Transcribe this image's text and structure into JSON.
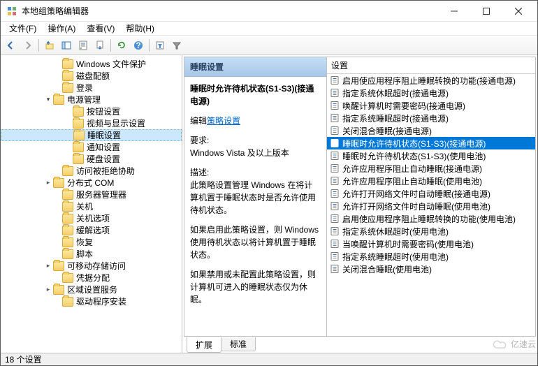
{
  "window": {
    "title": "本地组策略编辑器"
  },
  "menubar": {
    "items": [
      {
        "label": "文件(F)"
      },
      {
        "label": "操作(A)"
      },
      {
        "label": "查看(V)"
      },
      {
        "label": "帮助(H)"
      }
    ]
  },
  "toolbar": {
    "buttons": [
      {
        "name": "back-icon"
      },
      {
        "name": "forward-icon"
      },
      {
        "name": "up-icon"
      },
      {
        "name": "show-hide-tree-icon"
      },
      {
        "name": "properties-icon"
      },
      {
        "name": "export-icon"
      },
      {
        "name": "refresh-icon"
      },
      {
        "name": "help-icon"
      },
      {
        "name": "filter-options-icon"
      },
      {
        "name": "filter-icon"
      }
    ]
  },
  "tree": {
    "items": [
      {
        "indent": 75,
        "toggle": "",
        "label": "Windows 文件保护"
      },
      {
        "indent": 75,
        "toggle": "",
        "label": "磁盘配额"
      },
      {
        "indent": 75,
        "toggle": "",
        "label": "登录"
      },
      {
        "indent": 62,
        "toggle": "▾",
        "label": "电源管理",
        "open": true
      },
      {
        "indent": 90,
        "toggle": "",
        "label": "按钮设置"
      },
      {
        "indent": 90,
        "toggle": "",
        "label": "视频与显示设置"
      },
      {
        "indent": 90,
        "toggle": "",
        "label": "睡眠设置",
        "selected": true
      },
      {
        "indent": 90,
        "toggle": "",
        "label": "通知设置"
      },
      {
        "indent": 90,
        "toggle": "",
        "label": "硬盘设置"
      },
      {
        "indent": 75,
        "toggle": "",
        "label": "访问被拒绝协助"
      },
      {
        "indent": 62,
        "toggle": "▸",
        "label": "分布式 COM"
      },
      {
        "indent": 75,
        "toggle": "",
        "label": "服务器管理器"
      },
      {
        "indent": 75,
        "toggle": "",
        "label": "关机"
      },
      {
        "indent": 75,
        "toggle": "",
        "label": "关机选项"
      },
      {
        "indent": 75,
        "toggle": "",
        "label": "缓解选项"
      },
      {
        "indent": 75,
        "toggle": "",
        "label": "恢复"
      },
      {
        "indent": 75,
        "toggle": "",
        "label": "脚本"
      },
      {
        "indent": 62,
        "toggle": "▸",
        "label": "可移动存储访问"
      },
      {
        "indent": 75,
        "toggle": "",
        "label": "凭据分配"
      },
      {
        "indent": 62,
        "toggle": "▸",
        "label": "区域设置服务"
      },
      {
        "indent": 75,
        "toggle": "",
        "label": "驱动程序安装"
      }
    ]
  },
  "detail": {
    "header": "睡眠设置",
    "title": "睡眠时允许待机状态(S1-S3)(接通电源)",
    "edit_prefix": "编辑",
    "edit_link": "策略设置",
    "req_label": "要求:",
    "req_value": "Windows Vista 及以上版本",
    "desc_label": "描述:",
    "desc_p1": "此策略设置管理 Windows 在将计算机置于睡眠状态时是否允许使用待机状态。",
    "desc_p2": "如果启用此策略设置，则 Windows 使用待机状态以将计算机置于睡眠状态。",
    "desc_p3": "如果禁用或未配置此策略设置，则计算机可进入的睡眠状态仅为休眠。"
  },
  "list": {
    "header": "设置",
    "items": [
      {
        "label": "启用使应用程序阻止睡眠转换的功能(接通电源)"
      },
      {
        "label": "指定系统休眠超时(接通电源)"
      },
      {
        "label": "唤醒计算机时需要密码(接通电源)"
      },
      {
        "label": "指定系统睡眠超时(接通电源)"
      },
      {
        "label": "关闭混合睡眠(接通电源)"
      },
      {
        "label": "睡眠时允许待机状态(S1-S3)(接通电源)",
        "selected": true
      },
      {
        "label": "睡眠时允许待机状态(S1-S3)(使用电池)"
      },
      {
        "label": "允许应用程序阻止自动睡眠(接通电源)"
      },
      {
        "label": "允许应用程序阻止自动睡眠(使用电池)"
      },
      {
        "label": "允许打开网络文件时自动睡眠(接通电源)"
      },
      {
        "label": "允许打开网络文件时自动睡眠(使用电池)"
      },
      {
        "label": "启用使应用程序阻止睡眠转换的功能(使用电池)"
      },
      {
        "label": "指定系统休眠超时(使用电池)"
      },
      {
        "label": "当唤醒计算机时需要密码(使用电池)"
      },
      {
        "label": "指定系统睡眠超时(使用电池)"
      },
      {
        "label": "关闭混合睡眠(使用电池)"
      }
    ]
  },
  "tabs": {
    "items": [
      {
        "label": "扩展",
        "active": true
      },
      {
        "label": "标准",
        "active": false
      }
    ]
  },
  "statusbar": {
    "text": "18 个设置"
  },
  "watermark": {
    "text": "亿速云"
  }
}
